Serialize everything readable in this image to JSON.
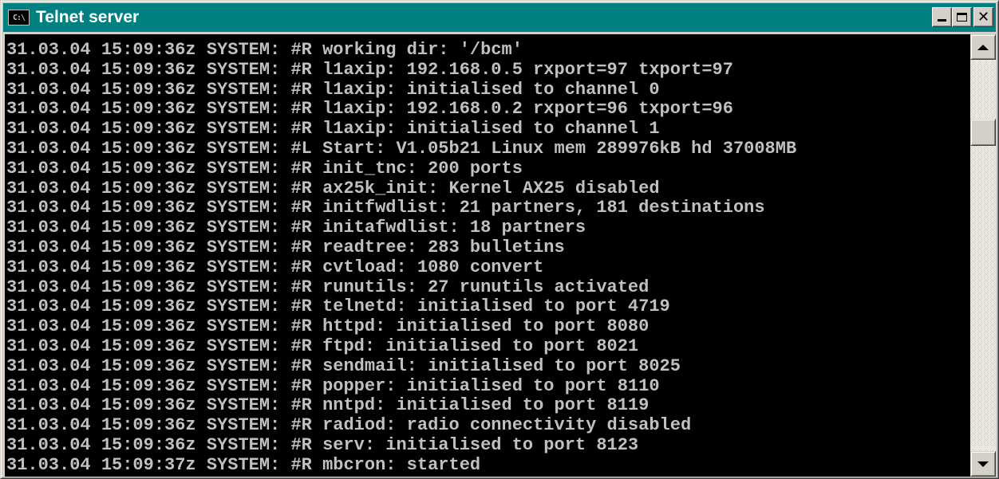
{
  "window": {
    "title": "Telnet server",
    "app_icon_text": "C:\\",
    "title_bar_color": "#008080"
  },
  "controls": {
    "minimize_icon": "minimize-icon",
    "maximize_icon": "maximize-icon",
    "close_icon": "close-icon",
    "close_glyph": "✕"
  },
  "console": {
    "foreground": "#c0c0c0",
    "background": "#000000",
    "lines": [
      "31.03.04 15:09:36z SYSTEM: #R working dir: '/bcm'",
      "31.03.04 15:09:36z SYSTEM: #R l1axip: 192.168.0.5 rxport=97 txport=97",
      "31.03.04 15:09:36z SYSTEM: #R l1axip: initialised to channel 0",
      "31.03.04 15:09:36z SYSTEM: #R l1axip: 192.168.0.2 rxport=96 txport=96",
      "31.03.04 15:09:36z SYSTEM: #R l1axip: initialised to channel 1",
      "31.03.04 15:09:36z SYSTEM: #L Start: V1.05b21 Linux mem 289976kB hd 37008MB",
      "31.03.04 15:09:36z SYSTEM: #R init_tnc: 200 ports",
      "31.03.04 15:09:36z SYSTEM: #R ax25k_init: Kernel AX25 disabled",
      "31.03.04 15:09:36z SYSTEM: #R initfwdlist: 21 partners, 181 destinations",
      "31.03.04 15:09:36z SYSTEM: #R initafwdlist: 18 partners",
      "31.03.04 15:09:36z SYSTEM: #R readtree: 283 bulletins",
      "31.03.04 15:09:36z SYSTEM: #R cvtload: 1080 convert",
      "31.03.04 15:09:36z SYSTEM: #R runutils: 27 runutils activated",
      "31.03.04 15:09:36z SYSTEM: #R telnetd: initialised to port 4719",
      "31.03.04 15:09:36z SYSTEM: #R httpd: initialised to port 8080",
      "31.03.04 15:09:36z SYSTEM: #R ftpd: initialised to port 8021",
      "31.03.04 15:09:36z SYSTEM: #R sendmail: initialised to port 8025",
      "31.03.04 15:09:36z SYSTEM: #R popper: initialised to port 8110",
      "31.03.04 15:09:36z SYSTEM: #R nntpd: initialised to port 8119",
      "31.03.04 15:09:36z SYSTEM: #R radiod: radio connectivity disabled",
      "31.03.04 15:09:36z SYSTEM: #R serv: initialised to port 8123",
      "31.03.04 15:09:37z SYSTEM: #R mbcron: started"
    ]
  },
  "scrollbar": {
    "up_icon": "scroll-up-arrow-icon",
    "down_icon": "scroll-down-arrow-icon"
  }
}
